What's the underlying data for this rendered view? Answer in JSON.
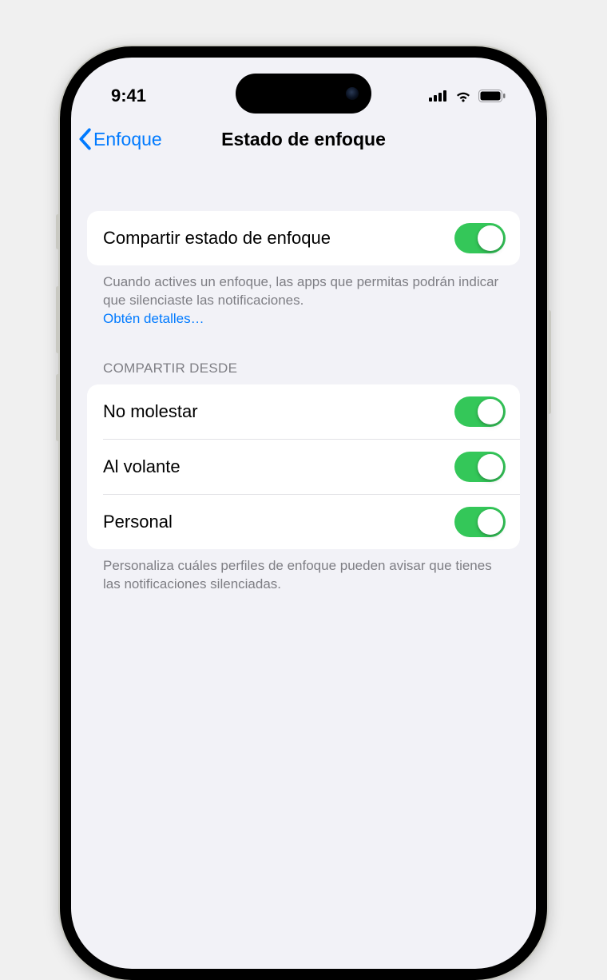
{
  "status_bar": {
    "time": "9:41"
  },
  "nav": {
    "back_label": "Enfoque",
    "title": "Estado de enfoque"
  },
  "share_section": {
    "toggle_label": "Compartir estado de enfoque",
    "toggle_on": true,
    "footer_text": "Cuando actives un enfoque, las apps que permitas podrán indicar que silenciaste las notificaciones. ",
    "footer_link": "Obtén detalles…"
  },
  "share_from": {
    "header": "COMPARTIR DESDE",
    "items": [
      {
        "label": "No molestar",
        "on": true
      },
      {
        "label": "Al volante",
        "on": true
      },
      {
        "label": "Personal",
        "on": true
      }
    ],
    "footer_text": "Personaliza cuáles perfiles de enfoque pueden avisar que tienes las notificaciones silenciadas."
  }
}
